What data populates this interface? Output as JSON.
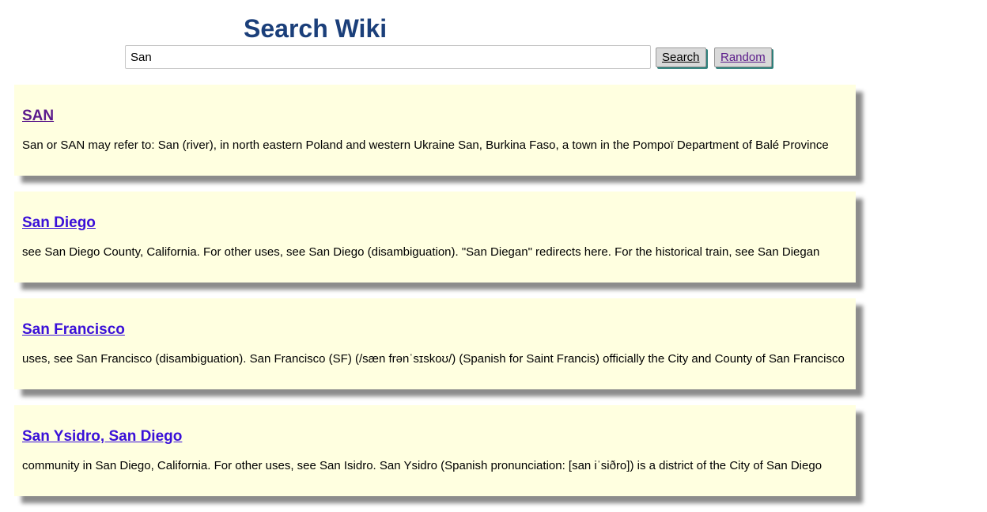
{
  "header": {
    "title": "Search Wiki",
    "search_value": "San",
    "search_button_label": "Search",
    "random_button_label": "Random"
  },
  "colors": {
    "title": "#1b3f7a",
    "card_background": "#ffffe0",
    "visited_link": "#5b1a8c",
    "unvisited_link": "#3a10d8",
    "button_shadow": "#2e7f7a"
  },
  "results": [
    {
      "title": "SAN",
      "visited": true,
      "snippet": "San or SAN may refer to: San (river), in north eastern Poland and western Ukraine San, Burkina Faso, a town in the Pompoï Department of Balé Province"
    },
    {
      "title": "San Diego",
      "visited": false,
      "snippet": "see San Diego County, California. For other uses, see San Diego (disambiguation). \"San Diegan\" redirects here. For the historical train, see San Diegan"
    },
    {
      "title": "San Francisco",
      "visited": false,
      "snippet": "uses, see San Francisco (disambiguation). San Francisco (SF) (/sæn frənˈsɪskoʊ/) (Spanish for Saint Francis) officially the City and County of San Francisco"
    },
    {
      "title": "San Ysidro, San Diego",
      "visited": false,
      "snippet": "community in San Diego, California. For other uses, see San Isidro. San Ysidro (Spanish pronunciation: [san iˈsiðro]) is a district of the City of San Diego"
    }
  ]
}
